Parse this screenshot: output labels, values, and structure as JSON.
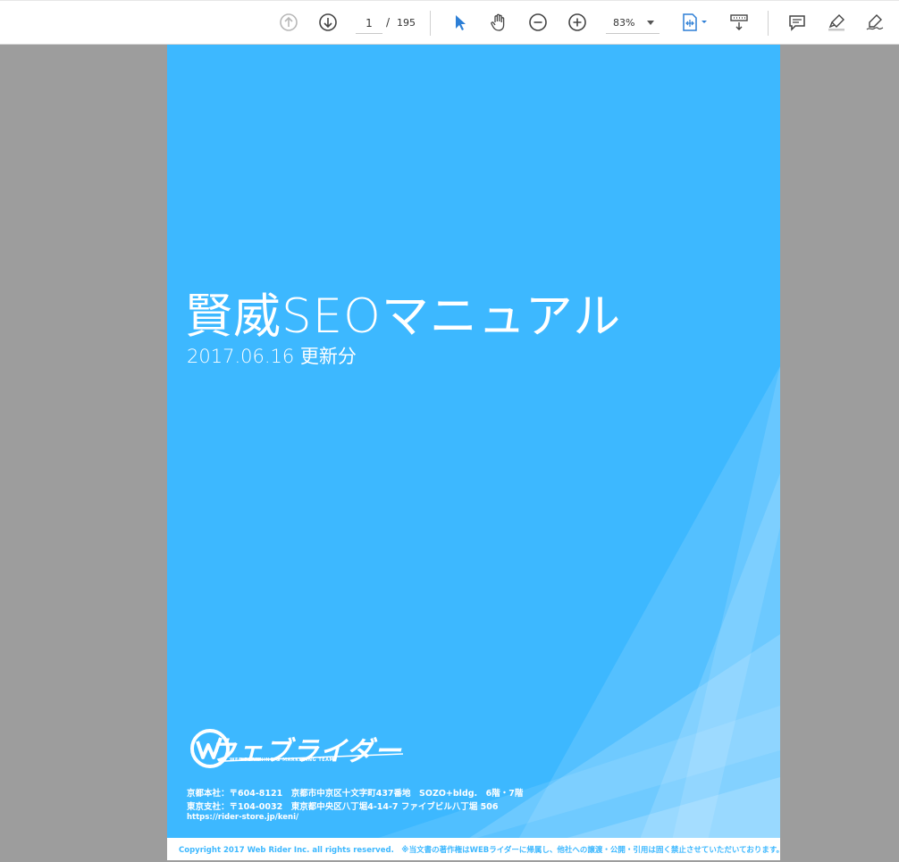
{
  "toolbar": {
    "page_current": "1",
    "page_separator": "/",
    "page_total": "195",
    "zoom": "83%",
    "icons": [
      "prev-page-icon",
      "next-page-icon",
      "select-cursor-icon",
      "hand-tool-icon",
      "zoom-out-icon",
      "zoom-in-icon",
      "fit-page-icon",
      "scroll-mode-icon",
      "comment-icon",
      "highlight-icon",
      "sign-icon"
    ],
    "accent_color": "#2d7fd6"
  },
  "document": {
    "title": "賢威SEOマニュアル",
    "subtitle": "2017.06.16 更新分",
    "logo_text": "ウェブライダー",
    "logo_subtext": "WEB PLANNING & MARKETING TEAM",
    "address_kyoto": "京都本社：〒604-8121　京都市中京区十文字町437番地　SOZO+bldg.　6階・7階",
    "address_tokyo": "東京支社：〒104-0032　東京都中央区八丁堀4-14-7 ファイブビル八丁堀 506",
    "url": "https://rider-store.jp/keni/",
    "copyright": "Copyright 2017  Web Rider Inc. all rights reserved.　※当文書の著作権はWEBライダーに帰属し、他社への譲渡・公開・引用は固く禁止させていただいております。",
    "page_color": "#3db8ff"
  }
}
